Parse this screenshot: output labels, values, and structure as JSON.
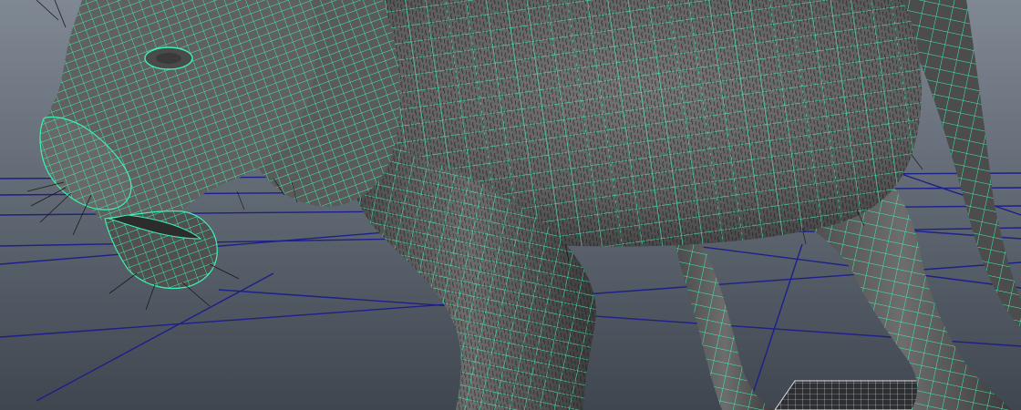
{
  "viewport": {
    "view": "perspective",
    "background_top": "#7f8893",
    "background_bottom": "#3f4650",
    "grid_color": "#1d1f8a",
    "wire_color": "#3ef0b0",
    "mesh_fill": "#5f5f60",
    "mesh_shadow": "#3a3a3b",
    "fur_color": "#141414"
  },
  "scene": {
    "model": "big-cat",
    "display_mode": "wireframe-on-shaded",
    "fur_preview": true,
    "grid_visible": true,
    "secondary_object": "grid-plane"
  }
}
